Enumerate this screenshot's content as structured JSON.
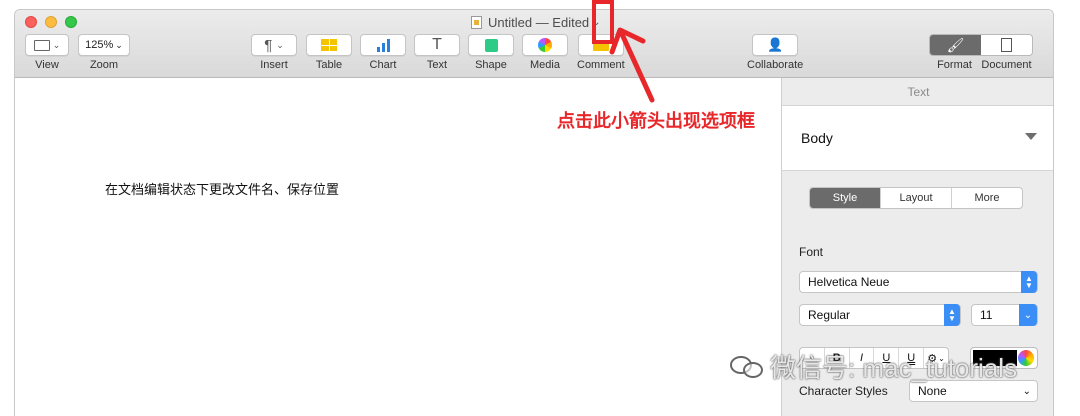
{
  "window": {
    "title": "Untitled — Edited",
    "title_chevron_icon": "chevron-down-icon"
  },
  "toolbar": {
    "view": {
      "label": "View",
      "icon": "sidebar-view-icon"
    },
    "zoom": {
      "label": "Zoom",
      "value": "125%"
    },
    "insert": {
      "label": "Insert",
      "icon": "pilcrow-icon",
      "glyph": "¶"
    },
    "table": {
      "label": "Table",
      "icon": "table-icon"
    },
    "chart": {
      "label": "Chart",
      "icon": "bar-chart-icon"
    },
    "text": {
      "label": "Text",
      "icon": "text-box-icon",
      "glyph": "T"
    },
    "shape": {
      "label": "Shape",
      "icon": "shape-square-icon"
    },
    "media": {
      "label": "Media",
      "icon": "photos-icon"
    },
    "comment": {
      "label": "Comment",
      "icon": "comment-icon"
    },
    "collaborate": {
      "label": "Collaborate",
      "icon": "add-person-icon"
    },
    "format": {
      "label": "Format",
      "icon": "paintbrush-icon"
    },
    "document": {
      "label": "Document",
      "icon": "document-icon"
    }
  },
  "document": {
    "body_text": "在文档编辑状态下更改文件名、保存位置"
  },
  "sidebar": {
    "header": "Text",
    "paragraph_style": "Body",
    "tabs": [
      {
        "label": "Style",
        "active": true
      },
      {
        "label": "Layout",
        "active": false
      },
      {
        "label": "More",
        "active": false
      }
    ],
    "font_section_label": "Font",
    "font_family": "Helvetica Neue",
    "font_typeface": "Regular",
    "font_size": "11",
    "format_buttons": [
      {
        "label": "•",
        "name": "bullet-button"
      },
      {
        "label": "B",
        "name": "bold-button"
      },
      {
        "label": "I",
        "name": "italic-button"
      },
      {
        "label": "U",
        "name": "underline-button"
      },
      {
        "label": "U̲",
        "name": "double-underline-button"
      },
      {
        "label": "⚙",
        "name": "text-options-button"
      }
    ],
    "text_color": "#000000",
    "character_styles_label": "Character Styles",
    "character_styles_value": "None"
  },
  "annotation": {
    "text": "点击此小箭头出现选项框",
    "color": "#e8272b"
  },
  "watermark": {
    "text": "微信号: mac_tutorials",
    "icon": "wechat-icon"
  },
  "colors": {
    "traffic_close": "#fc605c",
    "traffic_minimize": "#fdbc40",
    "traffic_maximize": "#34c84a",
    "accent_blue": "#3b8ef5"
  }
}
